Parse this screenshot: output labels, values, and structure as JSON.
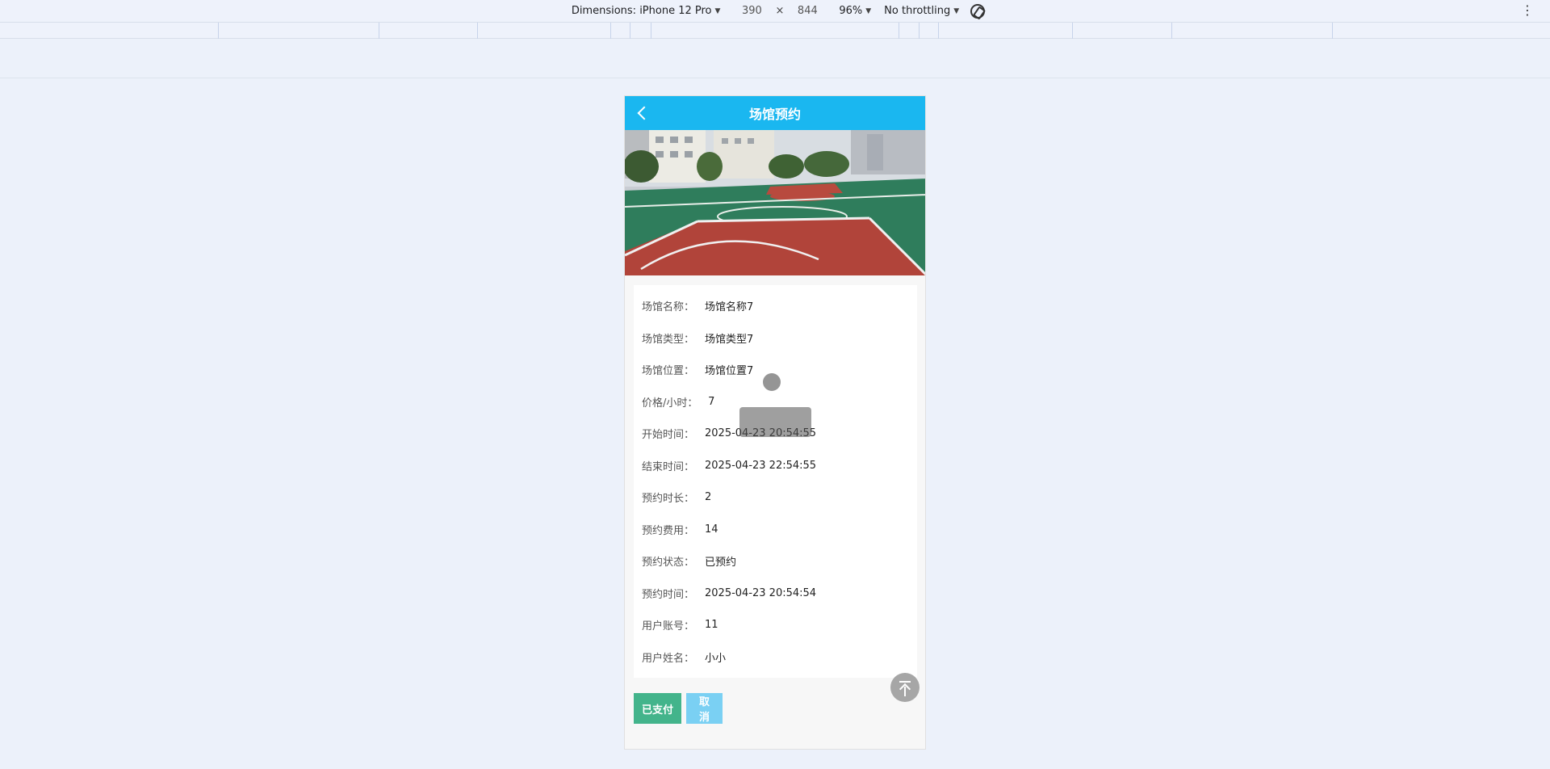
{
  "devtools": {
    "dimensions_label": "Dimensions: iPhone 12 Pro",
    "width": "390",
    "times": "×",
    "height": "844",
    "zoom": "96%",
    "throttling": "No throttling"
  },
  "app": {
    "title": "场馆预约",
    "hero_image": "basketball-court-photo"
  },
  "details": [
    {
      "label": "场馆名称：",
      "value": "场馆名称7"
    },
    {
      "label": "场馆类型：",
      "value": "场馆类型7"
    },
    {
      "label": "场馆位置：",
      "value": "场馆位置7"
    },
    {
      "label": "价格/小时：",
      "value": " 7"
    },
    {
      "label": "开始时间：",
      "value": "2025-04-23 20:54:55"
    },
    {
      "label": "结束时间：",
      "value": "2025-04-23 22:54:55"
    },
    {
      "label": "预约时长：",
      "value": "2"
    },
    {
      "label": "预约费用：",
      "value": "14"
    },
    {
      "label": "预约状态：",
      "value": "已预约"
    },
    {
      "label": "预约时间：",
      "value": "2025-04-23 20:54:54"
    },
    {
      "label": "用户账号：",
      "value": "11"
    },
    {
      "label": "用户姓名：",
      "value": "小小"
    }
  ],
  "actions": {
    "paid_label": "已支付",
    "cancel_label": "取消"
  },
  "colors": {
    "nav": "#1ab7f0",
    "paid_button": "#43b48b",
    "cancel_button": "#7ad0f3"
  }
}
